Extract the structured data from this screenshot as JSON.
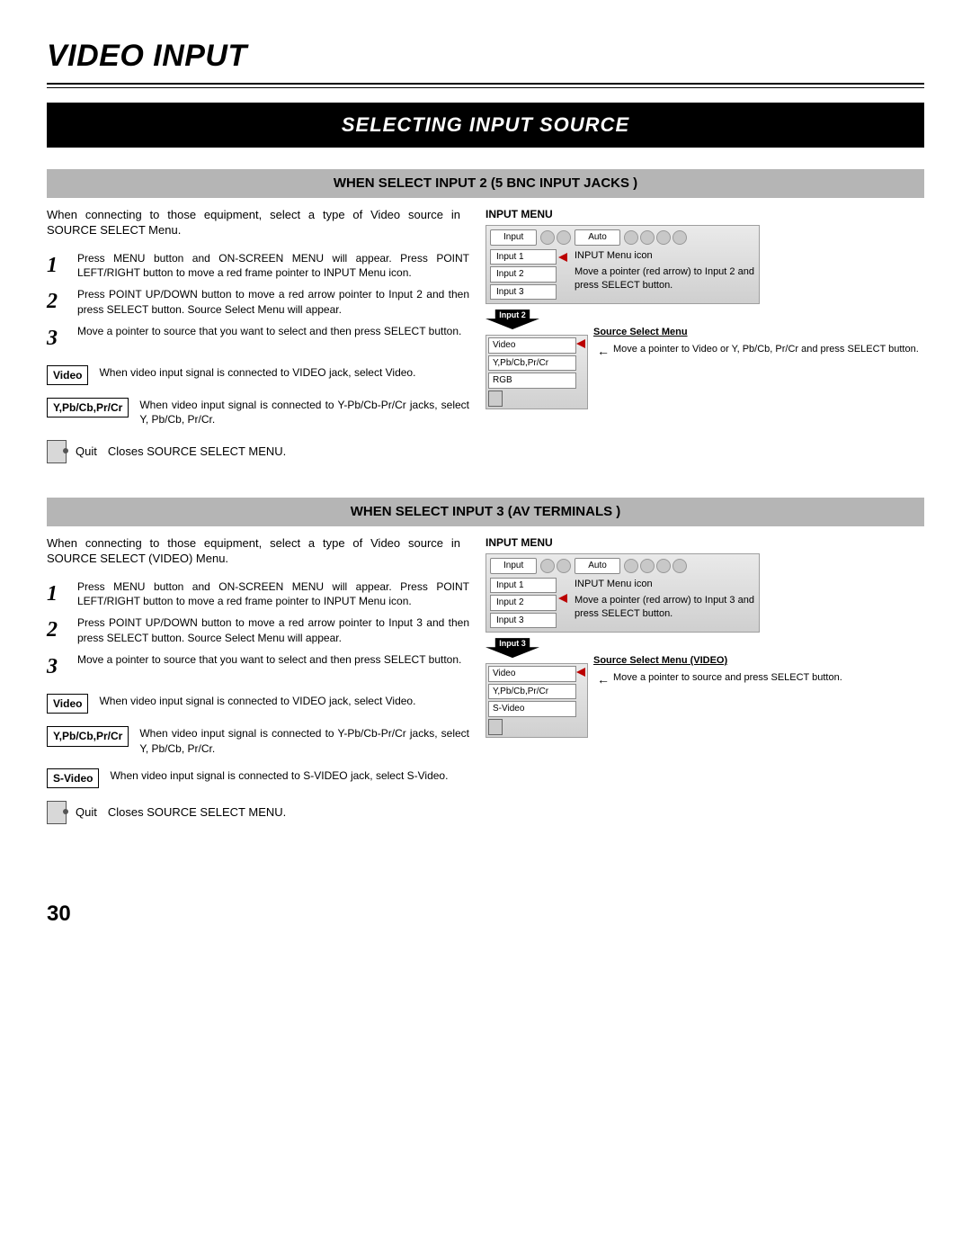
{
  "header": {
    "title": "VIDEO INPUT",
    "banner": "SELECTING INPUT SOURCE"
  },
  "page_num": "30",
  "sec1": {
    "subhead": "WHEN SELECT INPUT 2 (5 BNC INPUT JACKS )",
    "intro": "When connecting to those equipment, select a type of Video source in SOURCE SELECT Menu.",
    "steps": [
      "Press MENU button and ON-SCREEN MENU will appear.  Press POINT LEFT/RIGHT button to move a red frame pointer to INPUT Menu icon.",
      "Press POINT UP/DOWN button to move a red arrow pointer to Input 2 and then press SELECT button.  Source Select Menu will appear.",
      "Move a pointer to source that you want to select and then press SELECT button."
    ],
    "options": {
      "video_label": "Video",
      "video_desc": "When video input signal is connected to VIDEO jack, select Video.",
      "ypb_label": "Y,Pb/Cb,Pr/Cr",
      "ypb_desc": "When video input signal is connected to Y-Pb/Cb-Pr/Cr jacks, select Y, Pb/Cb, Pr/Cr.",
      "quit_label": "Quit",
      "quit_desc": "Closes SOURCE SELECT MENU."
    },
    "right": {
      "title": "INPUT MENU",
      "menu_input": "Input",
      "menu_auto": "Auto",
      "inputs": [
        "Input 1",
        "Input 2",
        "Input 3"
      ],
      "note1": "INPUT Menu icon",
      "note2": "Move a pointer (red arrow) to Input 2 and press SELECT button.",
      "arrow_label": "Input 2",
      "src_title": "Source Select Menu",
      "src_items": [
        "Video",
        "Y,Pb/Cb,Pr/Cr",
        "RGB"
      ],
      "src_note": "Move a pointer to Video or Y, Pb/Cb, Pr/Cr and press SELECT button."
    }
  },
  "sec2": {
    "subhead": "WHEN SELECT INPUT 3 (AV TERMINALS )",
    "intro": "When connecting to those equipment, select a type of Video source in SOURCE SELECT (VIDEO) Menu.",
    "steps": [
      "Press MENU button and ON-SCREEN MENU will appear.  Press POINT LEFT/RIGHT button to move a red frame pointer to INPUT Menu icon.",
      "Press POINT UP/DOWN button to move a red arrow pointer to Input 3 and then press SELECT button.  Source Select Menu will appear.",
      "Move a pointer to source that you want to select and then press SELECT button."
    ],
    "options": {
      "video_label": "Video",
      "video_desc": "When video input signal is connected to VIDEO jack, select Video.",
      "ypb_label": "Y,Pb/Cb,Pr/Cr",
      "ypb_desc": "When video input signal is connected to Y-Pb/Cb-Pr/Cr jacks, select Y, Pb/Cb, Pr/Cr.",
      "svideo_label": "S-Video",
      "svideo_desc": "When video input signal is connected to S-VIDEO jack, select S-Video.",
      "quit_label": "Quit",
      "quit_desc": "Closes SOURCE SELECT MENU."
    },
    "right": {
      "title": "INPUT MENU",
      "menu_input": "Input",
      "menu_auto": "Auto",
      "inputs": [
        "Input 1",
        "Input 2",
        "Input 3"
      ],
      "note1": "INPUT Menu icon",
      "note2": "Move a pointer (red arrow) to Input 3 and press SELECT button.",
      "arrow_label": "Input 3",
      "src_title": "Source Select Menu (VIDEO)",
      "src_items": [
        "Video",
        "Y,Pb/Cb,Pr/Cr",
        "S-Video"
      ],
      "src_note": "Move a pointer to source and press SELECT button."
    }
  }
}
